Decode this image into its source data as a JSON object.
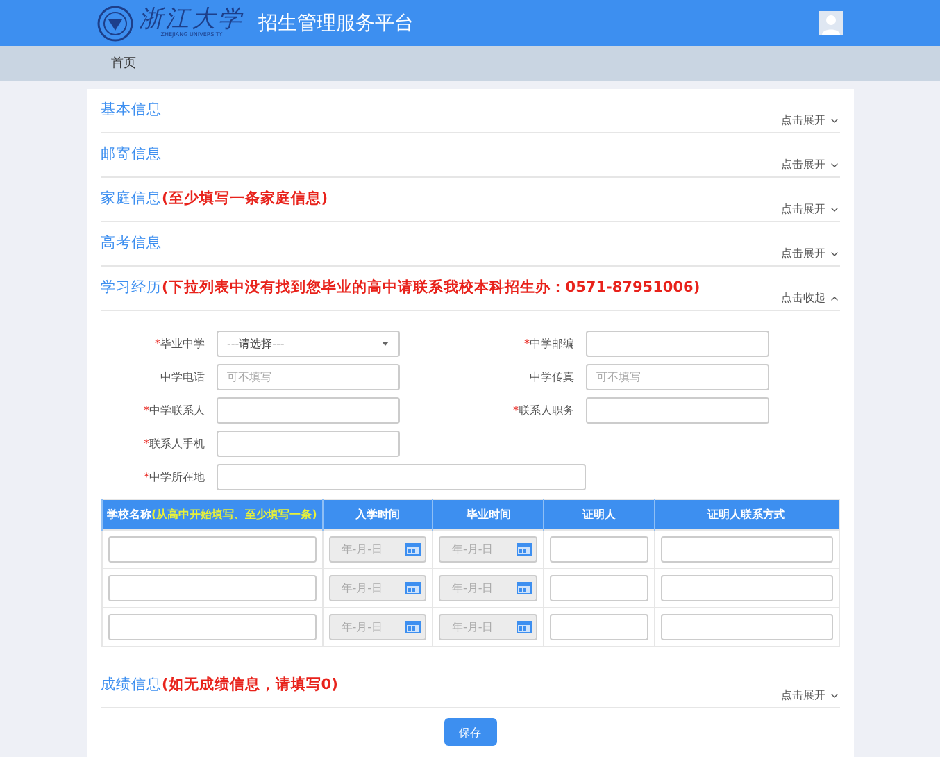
{
  "header": {
    "logo_text": "浙江大学",
    "logo_subtext": "ZHEJIANG UNIVERSITY",
    "title": "招生管理服务平台"
  },
  "breadcrumb": [
    "首页"
  ],
  "sections": [
    {
      "title": "基本信息",
      "expanded": false,
      "toggle": "点击展开"
    },
    {
      "title": "邮寄信息",
      "expanded": false,
      "toggle": "点击展开"
    },
    {
      "title": "家庭信息",
      "note": "(至少填写一条家庭信息)",
      "expanded": false,
      "toggle": "点击展开"
    },
    {
      "title": "高考信息",
      "expanded": false,
      "toggle": "点击展开"
    },
    {
      "title": "学习经历",
      "note": "(下拉列表中没有找到您毕业的高中请联系我校本科招生办：0571-87951006)",
      "expanded": true,
      "toggle": "点击收起",
      "fields": [
        {
          "label": "毕业中学",
          "required_mark": "*",
          "kind": "select",
          "value": "---请选择---"
        },
        {
          "label": "中学邮编",
          "required_mark": "*",
          "kind": "text"
        },
        {
          "label": "中学电话",
          "kind": "text",
          "placeholder": "可不填写"
        },
        {
          "label": "中学传真",
          "kind": "text",
          "placeholder": "可不填写"
        },
        {
          "label": "中学联系人",
          "required_mark": "*",
          "kind": "text"
        },
        {
          "label": "联系人职务",
          "required_mark": "*",
          "kind": "text"
        },
        {
          "label": "联系人手机",
          "required_mark": "*",
          "kind": "text"
        },
        {
          "label": "中学所在地",
          "required_mark": "*",
          "kind": "wide"
        }
      ],
      "table": {
        "columns": [
          {
            "label": "学校名称",
            "note": "(从高中开始填写、至少填写一条)"
          },
          {
            "label": "入学时间"
          },
          {
            "label": "毕业时间"
          },
          {
            "label": "证明人"
          },
          {
            "label": "证明人联系方式"
          }
        ],
        "rows": [
          [
            {
              "kind": "text"
            },
            {
              "kind": "date",
              "placeholder": "年-月-日"
            },
            {
              "kind": "date",
              "placeholder": "年-月-日"
            },
            {
              "kind": "text"
            },
            {
              "kind": "text"
            }
          ],
          [
            {
              "kind": "text"
            },
            {
              "kind": "date",
              "placeholder": "年-月-日"
            },
            {
              "kind": "date",
              "placeholder": "年-月-日"
            },
            {
              "kind": "text"
            },
            {
              "kind": "text"
            }
          ],
          [
            {
              "kind": "text"
            },
            {
              "kind": "date",
              "placeholder": "年-月-日"
            },
            {
              "kind": "date",
              "placeholder": "年-月-日"
            },
            {
              "kind": "text"
            },
            {
              "kind": "text"
            }
          ]
        ]
      }
    },
    {
      "title": "成绩信息",
      "note": "(如无成绩信息，请填写0)",
      "expanded": false,
      "toggle": "点击展开"
    }
  ],
  "save_button": "保存"
}
